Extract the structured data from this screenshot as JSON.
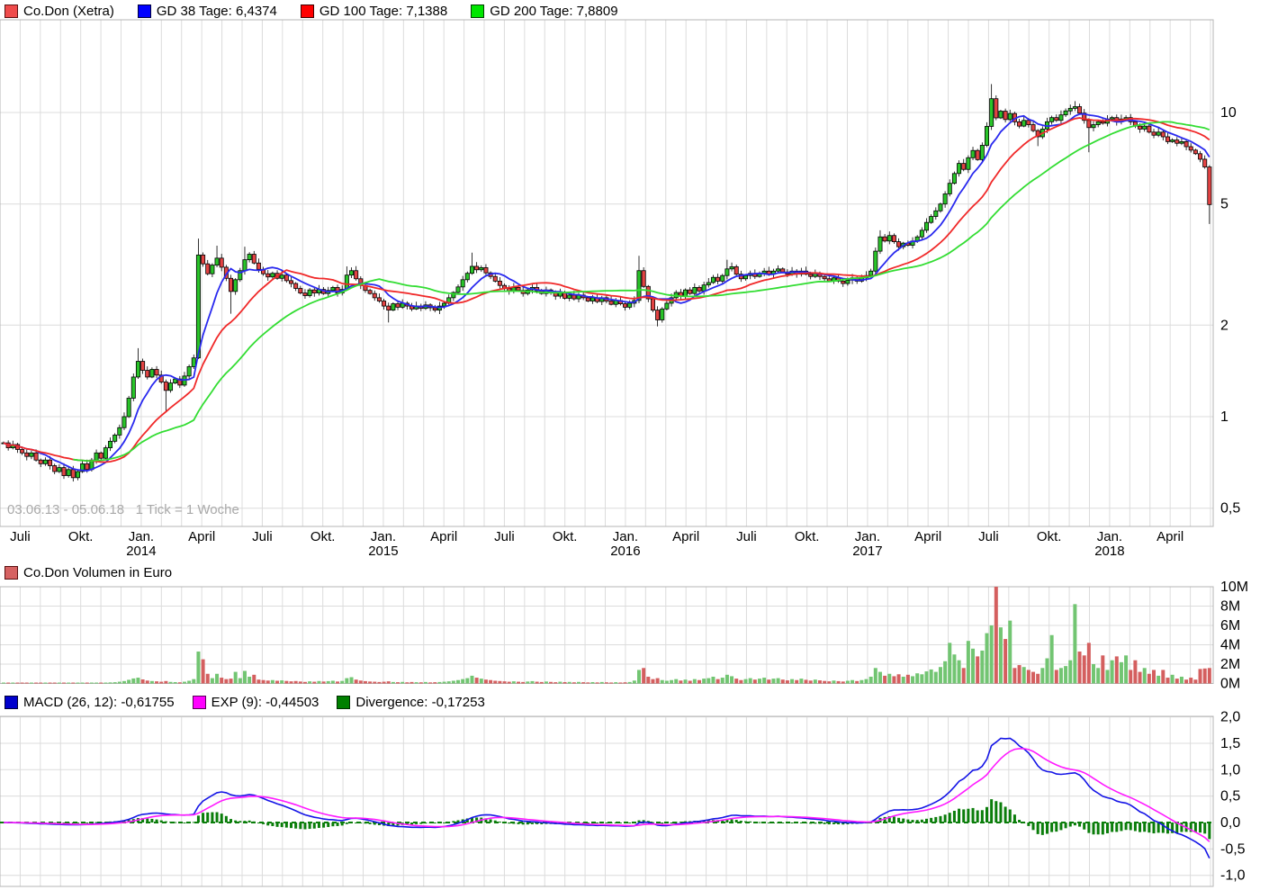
{
  "title": "Co.Don (Xetra)",
  "range_note": "03.06.13 - 05.06.18   1 Tick = 1 Woche",
  "price_legend": {
    "items": [
      {
        "label": "Co.Don (Xetra)",
        "color": "#ef4b4b",
        "border": "#5a1010"
      },
      {
        "label": "GD 38 Tage: 6,4374",
        "color": "#0000ff",
        "border": "#00003c"
      },
      {
        "label": "GD 100 Tage: 7,1388",
        "color": "#ff0000",
        "border": "#3c0000"
      },
      {
        "label": "GD 200 Tage: 7,8809",
        "color": "#00e600",
        "border": "#003c00"
      }
    ]
  },
  "volume_legend": {
    "items": [
      {
        "label": "Co.Don Volumen in Euro",
        "color": "#d66262",
        "border": "#5a1010"
      }
    ]
  },
  "macd_legend": {
    "items": [
      {
        "label": "MACD (26, 12): -0,61755",
        "color": "#0000cc",
        "border": "#000033"
      },
      {
        "label": "EXP (9): -0,44503",
        "color": "#ff00ff",
        "border": "#550055"
      },
      {
        "label": "Divergence: -0,17253",
        "color": "#008000",
        "border": "#002b00"
      }
    ]
  },
  "chart_data": {
    "type": "multi-panel-stock-chart",
    "instrument": "Co.Don (Xetra)",
    "period": {
      "start": "03.06.13",
      "end": "05.06.18",
      "tick": "1 Woche",
      "weeks": 261
    },
    "price": {
      "type": "candlestick",
      "scale": "log",
      "up_color": "#29c429",
      "down_color": "#e34343",
      "outline": "#000000",
      "y_ticks": [
        {
          "v": 10,
          "l": "10"
        },
        {
          "v": 5,
          "l": "5"
        },
        {
          "v": 2,
          "l": "2"
        },
        {
          "v": 1,
          "l": "1"
        },
        {
          "v": 0.5,
          "l": "0,5"
        }
      ],
      "closes": [
        0.82,
        0.79,
        0.81,
        0.78,
        0.76,
        0.74,
        0.76,
        0.72,
        0.7,
        0.72,
        0.69,
        0.66,
        0.68,
        0.64,
        0.67,
        0.63,
        0.66,
        0.7,
        0.67,
        0.72,
        0.76,
        0.73,
        0.79,
        0.83,
        0.87,
        0.92,
        1.0,
        1.15,
        1.35,
        1.52,
        1.42,
        1.35,
        1.43,
        1.37,
        1.3,
        1.22,
        1.29,
        1.33,
        1.27,
        1.36,
        1.46,
        1.56,
        3.4,
        3.18,
        2.95,
        3.15,
        3.32,
        3.1,
        2.85,
        2.58,
        2.82,
        3.02,
        3.28,
        3.42,
        3.2,
        3.05,
        2.95,
        2.88,
        2.96,
        2.85,
        2.92,
        2.8,
        2.74,
        2.64,
        2.55,
        2.5,
        2.61,
        2.55,
        2.62,
        2.54,
        2.6,
        2.66,
        2.55,
        2.62,
        2.92,
        3.02,
        2.84,
        2.7,
        2.6,
        2.54,
        2.46,
        2.4,
        2.31,
        2.24,
        2.35,
        2.29,
        2.36,
        2.31,
        2.26,
        2.31,
        2.27,
        2.33,
        2.28,
        2.24,
        2.31,
        2.36,
        2.46,
        2.56,
        2.67,
        2.82,
        2.96,
        3.12,
        3.04,
        3.09,
        2.97,
        2.89,
        2.79,
        2.7,
        2.64,
        2.59,
        2.66,
        2.6,
        2.54,
        2.61,
        2.66,
        2.59,
        2.54,
        2.61,
        2.55,
        2.49,
        2.56,
        2.45,
        2.51,
        2.44,
        2.51,
        2.46,
        2.4,
        2.46,
        2.39,
        2.46,
        2.4,
        2.34,
        2.41,
        2.35,
        2.29,
        2.36,
        2.41,
        3.02,
        2.68,
        2.44,
        2.24,
        2.08,
        2.26,
        2.36,
        2.46,
        2.56,
        2.49,
        2.61,
        2.54,
        2.66,
        2.59,
        2.71,
        2.76,
        2.87,
        2.79,
        2.91,
        3.06,
        3.11,
        2.94,
        2.84,
        2.91,
        2.96,
        2.89,
        2.96,
        3.01,
        2.94,
        3.01,
        3.06,
        2.99,
        2.94,
        3.01,
        2.94,
        3.01,
        2.94,
        2.89,
        2.96,
        2.89,
        2.84,
        2.79,
        2.86,
        2.79,
        2.74,
        2.81,
        2.86,
        2.79,
        2.86,
        2.91,
        3.01,
        3.5,
        3.9,
        3.78,
        3.94,
        3.76,
        3.62,
        3.72,
        3.66,
        3.78,
        3.9,
        4.1,
        4.35,
        4.55,
        4.75,
        5.0,
        5.4,
        5.85,
        6.3,
        6.8,
        6.5,
        7.1,
        7.5,
        7.0,
        7.8,
        9.0,
        11.1,
        9.6,
        10.1,
        9.48,
        9.92,
        9.32,
        9.02,
        9.42,
        9.12,
        8.72,
        8.32,
        8.82,
        9.32,
        9.62,
        9.42,
        9.82,
        10.12,
        10.32,
        10.45,
        9.95,
        9.42,
        8.92,
        9.12,
        9.32,
        9.22,
        9.52,
        9.62,
        9.32,
        9.52,
        9.62,
        9.32,
        9.02,
        8.82,
        9.02,
        8.62,
        8.42,
        8.62,
        8.32,
        8.02,
        8.12,
        7.92,
        8.02,
        7.72,
        7.52,
        7.32,
        7.02,
        6.62,
        4.98
      ],
      "hl_overrides": {
        "29": [
          1.68,
          null
        ],
        "35": [
          null,
          1.04
        ],
        "42": [
          3.85,
          null
        ],
        "46": [
          3.65,
          null
        ],
        "49": [
          null,
          2.18
        ],
        "52": [
          3.62,
          null
        ],
        "74": [
          3.12,
          null
        ],
        "83": [
          null,
          2.04
        ],
        "101": [
          3.46,
          null
        ],
        "137": [
          3.38,
          null
        ],
        "141": [
          null,
          1.98
        ],
        "156": [
          3.28,
          null
        ],
        "189": [
          4.1,
          null
        ],
        "213": [
          12.4,
          null
        ],
        "223": [
          null,
          7.75
        ],
        "231": [
          10.9,
          null
        ],
        "234": [
          null,
          7.4
        ],
        "260": [
          null,
          4.3
        ]
      },
      "moving_averages": [
        {
          "name": "GD 38 Tage",
          "value": "6,4374",
          "weeks": 8,
          "color": "#2929ef",
          "start_index": 0
        },
        {
          "name": "GD 100 Tage",
          "value": "7,1388",
          "weeks": 20,
          "color": "#f02929",
          "start_index": 0
        },
        {
          "name": "GD 200 Tage",
          "value": "7,8809",
          "weeks": 40,
          "color": "#33dd33",
          "start_index": 15
        }
      ]
    },
    "volume": {
      "type": "bar",
      "title": "Co.Don Volumen in Euro",
      "unit": "millions EUR",
      "up_color": "#72c572",
      "down_color": "#d45f5f",
      "y_ticks": [
        {
          "v": 10,
          "l": "10M"
        },
        {
          "v": 8,
          "l": "8M"
        },
        {
          "v": 6,
          "l": "6M"
        },
        {
          "v": 4,
          "l": "4M"
        },
        {
          "v": 2,
          "l": "2M"
        },
        {
          "v": 0,
          "l": "0M"
        }
      ],
      "values": [
        0.06,
        0.04,
        0.05,
        0.03,
        0.05,
        0.04,
        0.06,
        0.04,
        0.05,
        0.06,
        0.05,
        0.07,
        0.04,
        0.06,
        0.05,
        0.07,
        0.05,
        0.06,
        0.05,
        0.07,
        0.08,
        0.06,
        0.09,
        0.11,
        0.13,
        0.18,
        0.25,
        0.38,
        0.52,
        0.6,
        0.42,
        0.3,
        0.25,
        0.22,
        0.18,
        0.25,
        0.16,
        0.14,
        0.12,
        0.18,
        0.28,
        0.45,
        3.3,
        2.5,
        1.0,
        0.55,
        1.0,
        0.6,
        0.45,
        0.5,
        1.2,
        0.55,
        1.3,
        0.7,
        0.9,
        0.4,
        0.35,
        0.3,
        0.35,
        0.28,
        0.32,
        0.26,
        0.22,
        0.25,
        0.2,
        0.16,
        0.22,
        0.18,
        0.25,
        0.2,
        0.24,
        0.28,
        0.2,
        0.26,
        0.55,
        0.65,
        0.4,
        0.3,
        0.24,
        0.2,
        0.18,
        0.15,
        0.18,
        0.22,
        0.15,
        0.13,
        0.16,
        0.12,
        0.15,
        0.13,
        0.12,
        0.15,
        0.11,
        0.13,
        0.15,
        0.18,
        0.22,
        0.28,
        0.35,
        0.45,
        0.55,
        0.8,
        0.6,
        0.5,
        0.4,
        0.35,
        0.28,
        0.25,
        0.22,
        0.18,
        0.22,
        0.18,
        0.15,
        0.2,
        0.24,
        0.18,
        0.15,
        0.2,
        0.16,
        0.13,
        0.18,
        0.14,
        0.16,
        0.12,
        0.16,
        0.13,
        0.11,
        0.14,
        0.11,
        0.15,
        0.12,
        0.1,
        0.13,
        0.1,
        0.12,
        0.15,
        0.3,
        1.4,
        1.6,
        0.7,
        0.45,
        0.55,
        0.35,
        0.28,
        0.35,
        0.45,
        0.3,
        0.4,
        0.28,
        0.45,
        0.35,
        0.5,
        0.55,
        0.7,
        0.45,
        0.6,
        0.9,
        0.75,
        0.5,
        0.35,
        0.45,
        0.55,
        0.4,
        0.5,
        0.6,
        0.4,
        0.5,
        0.55,
        0.4,
        0.32,
        0.45,
        0.35,
        0.5,
        0.38,
        0.3,
        0.4,
        0.32,
        0.26,
        0.22,
        0.3,
        0.24,
        0.2,
        0.28,
        0.35,
        0.25,
        0.35,
        0.45,
        0.7,
        1.6,
        1.2,
        0.8,
        1.0,
        0.75,
        0.95,
        0.7,
        0.9,
        0.75,
        1.05,
        0.95,
        1.25,
        1.45,
        1.2,
        1.7,
        2.3,
        4.2,
        3.0,
        2.4,
        1.6,
        4.4,
        3.6,
        2.8,
        3.4,
        5.2,
        6.0,
        10.0,
        5.8,
        4.6,
        6.5,
        1.6,
        1.9,
        1.7,
        1.4,
        1.2,
        1.0,
        1.6,
        2.6,
        5.0,
        1.4,
        1.6,
        1.8,
        2.4,
        8.2,
        3.3,
        2.9,
        4.2,
        2.0,
        1.6,
        2.9,
        1.4,
        2.4,
        2.8,
        2.2,
        2.9,
        1.4,
        2.4,
        1.2,
        1.6,
        1.0,
        1.4,
        0.8,
        1.4,
        0.6,
        0.9,
        0.5,
        0.7,
        0.4,
        0.6,
        0.4,
        1.5,
        1.55,
        1.6
      ]
    },
    "macd": {
      "type": "macd",
      "slow": 26,
      "fast": 12,
      "signal": 9,
      "macd_value": "-0,61755",
      "exp_value": "-0,44503",
      "divergence_value": "-0,17253",
      "line_color": "#1414e6",
      "signal_color": "#ff1aff",
      "hist_color": "#0a7d0a",
      "y_ticks": [
        {
          "v": 2,
          "l": "2,0"
        },
        {
          "v": 1.5,
          "l": "1,5"
        },
        {
          "v": 1,
          "l": "1,0"
        },
        {
          "v": 0.5,
          "l": "0,5"
        },
        {
          "v": 0,
          "l": "0,0"
        },
        {
          "v": -0.5,
          "l": "-0,5"
        },
        {
          "v": -1,
          "l": "-1,0"
        }
      ]
    },
    "x_axis": {
      "months_total": 60,
      "labels": [
        {
          "m": 1,
          "q": "Juli"
        },
        {
          "m": 4,
          "q": "Okt."
        },
        {
          "m": 7,
          "q": "Jan.",
          "y": "2014"
        },
        {
          "m": 10,
          "q": "April"
        },
        {
          "m": 13,
          "q": "Juli"
        },
        {
          "m": 16,
          "q": "Okt."
        },
        {
          "m": 19,
          "q": "Jan.",
          "y": "2015"
        },
        {
          "m": 22,
          "q": "April"
        },
        {
          "m": 25,
          "q": "Juli"
        },
        {
          "m": 28,
          "q": "Okt."
        },
        {
          "m": 31,
          "q": "Jan.",
          "y": "2016"
        },
        {
          "m": 34,
          "q": "April"
        },
        {
          "m": 37,
          "q": "Juli"
        },
        {
          "m": 40,
          "q": "Okt."
        },
        {
          "m": 43,
          "q": "Jan.",
          "y": "2017"
        },
        {
          "m": 46,
          "q": "April"
        },
        {
          "m": 49,
          "q": "Juli"
        },
        {
          "m": 52,
          "q": "Okt."
        },
        {
          "m": 55,
          "q": "Jan.",
          "y": "2018"
        },
        {
          "m": 58,
          "q": "April"
        }
      ]
    },
    "grid_color": "#dcdcdc",
    "border_color": "#b4b4b4"
  }
}
